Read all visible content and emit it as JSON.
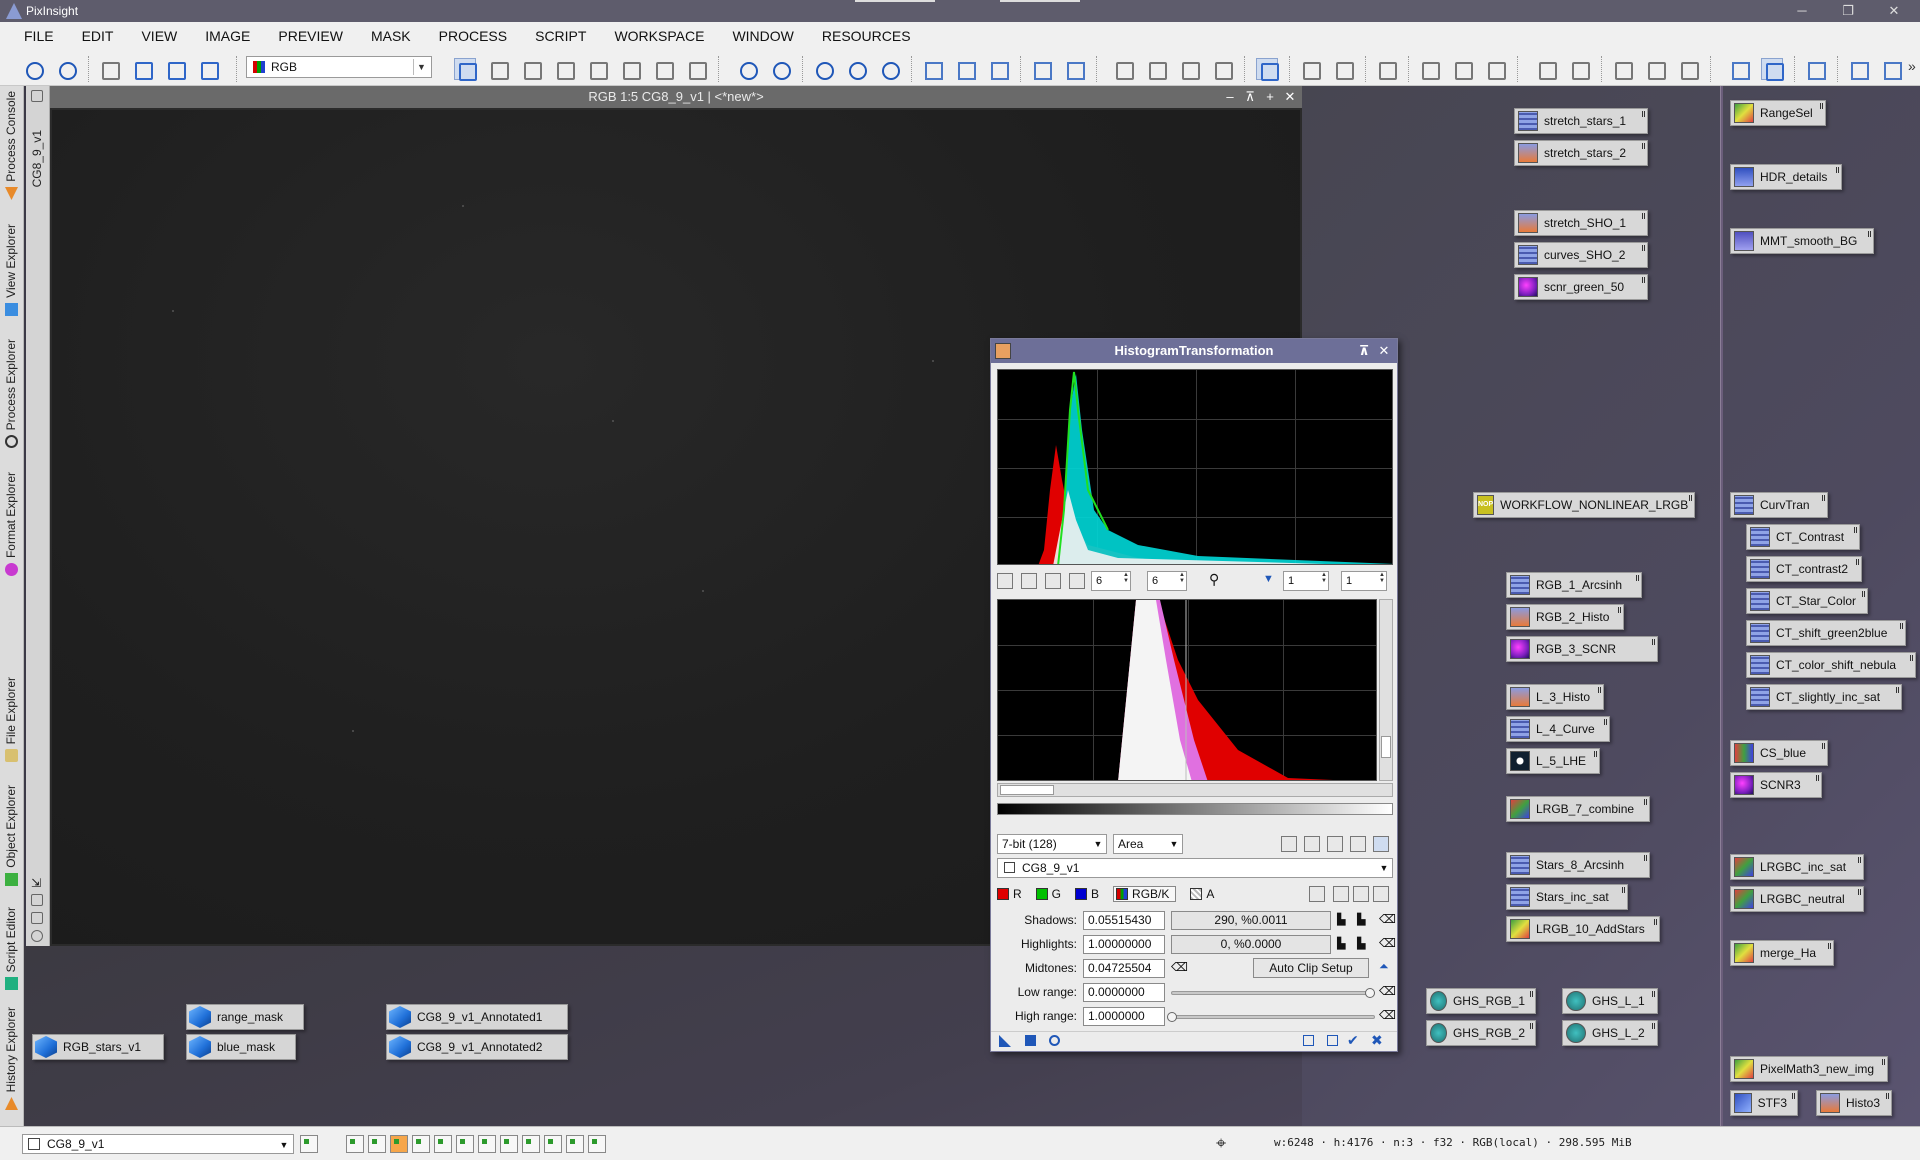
{
  "app": {
    "title": "PixInsight"
  },
  "menu": [
    "FILE",
    "EDIT",
    "VIEW",
    "IMAGE",
    "PREVIEW",
    "MASK",
    "PROCESS",
    "SCRIPT",
    "WORKSPACE",
    "WINDOW",
    "RESOURCES"
  ],
  "toolbar": {
    "channel_select": "RGB",
    "overflow": "»"
  },
  "left_dock": [
    "Process Console",
    "View Explorer",
    "Process Explorer",
    "Format Explorer",
    "File Explorer",
    "Object Explorer",
    "Script Editor",
    "History Explorer"
  ],
  "image_window": {
    "title": "RGB 1:5 CG8_9_v1 | <*new*>",
    "side_label": "CG8_9_v1"
  },
  "process_icons": [
    {
      "label": "stretch_stars_1",
      "kind": "grid"
    },
    {
      "label": "stretch_stars_2",
      "kind": "histo"
    },
    {
      "label": "stretch_SHO_1",
      "kind": "histo"
    },
    {
      "label": "curves_SHO_2",
      "kind": "grid"
    },
    {
      "label": "scnr_green_50",
      "kind": "scnr"
    },
    {
      "label": "WORKFLOW_NONLINEAR_LRGB",
      "kind": "nop"
    },
    {
      "label": "RGB_1_Arcsinh",
      "kind": "grid"
    },
    {
      "label": "RGB_2_Histo",
      "kind": "histo"
    },
    {
      "label": "RGB_3_SCNR",
      "kind": "scnr"
    },
    {
      "label": "L_3_Histo",
      "kind": "histo"
    },
    {
      "label": "L_4_Curve",
      "kind": "grid"
    },
    {
      "label": "L_5_LHE",
      "kind": "lhe"
    },
    {
      "label": "LRGB_7_combine",
      "kind": "lrgb"
    },
    {
      "label": "Stars_8_Arcsinh",
      "kind": "grid"
    },
    {
      "label": "Stars_inc_sat",
      "kind": "grid"
    },
    {
      "label": "LRGB_10_AddStars",
      "kind": "pm"
    },
    {
      "label": "GHS_RGB_1",
      "kind": "ghs"
    },
    {
      "label": "GHS_L_1",
      "kind": "ghs"
    },
    {
      "label": "GHS_RGB_2",
      "kind": "ghs"
    },
    {
      "label": "GHS_L_2",
      "kind": "ghs"
    },
    {
      "label": "RangeSel",
      "kind": "pm"
    },
    {
      "label": "HDR_details",
      "kind": "hdr"
    },
    {
      "label": "MMT_smooth_BG",
      "kind": "mmt"
    },
    {
      "label": "CurvTran",
      "kind": "grid"
    },
    {
      "label": "CT_Contrast",
      "kind": "grid"
    },
    {
      "label": "CT_contrast2",
      "kind": "grid"
    },
    {
      "label": "CT_Star_Color",
      "kind": "grid"
    },
    {
      "label": "CT_shift_green2blue",
      "kind": "grid"
    },
    {
      "label": "CT_color_shift_nebula",
      "kind": "grid"
    },
    {
      "label": "CT_slightly_inc_sat",
      "kind": "grid"
    },
    {
      "label": "CS_blue",
      "kind": "cs"
    },
    {
      "label": "SCNR3",
      "kind": "scnr"
    },
    {
      "label": "LRGBC_inc_sat",
      "kind": "lrgb"
    },
    {
      "label": "LRGBC_neutral",
      "kind": "lrgb"
    },
    {
      "label": "merge_Ha",
      "kind": "pm"
    },
    {
      "label": "PixelMath3_new_img",
      "kind": "pm"
    },
    {
      "label": "STF3",
      "kind": "stf"
    },
    {
      "label": "Histo3",
      "kind": "histo"
    }
  ],
  "image_icons": [
    {
      "label": "RGB_stars_v1"
    },
    {
      "label": "range_mask"
    },
    {
      "label": "blue_mask"
    },
    {
      "label": "CG8_9_v1_Annotated1"
    },
    {
      "label": "CG8_9_v1_Annotated2"
    }
  ],
  "histogram_dialog": {
    "title": "HistogramTransformation",
    "zoom_h": "6",
    "zoom_v": "6",
    "out_zoom_h": "1",
    "out_zoom_v": "1",
    "resolution": "7-bit (128)",
    "graph_style": "Area",
    "view": "CG8_9_v1",
    "channels": [
      {
        "label": "R",
        "color": "#e00000"
      },
      {
        "label": "G",
        "color": "#00c000"
      },
      {
        "label": "B",
        "color": "#0000d0"
      },
      {
        "label": "RGB/K",
        "color": "#1f3fbf"
      },
      {
        "label": "A",
        "color": "#888888"
      }
    ],
    "shadows_label": "Shadows:",
    "shadows": "0.05515430",
    "shadows_clip": "290, %0.0011",
    "highlights_label": "Highlights:",
    "highlights": "1.00000000",
    "highlights_clip": "0, %0.0000",
    "midtones_label": "Midtones:",
    "midtones": "0.04725504",
    "auto_clip": "Auto Clip Setup",
    "low_range_label": "Low range:",
    "low_range": "0.0000000",
    "high_range_label": "High range:",
    "high_range": "1.0000000"
  },
  "statusbar": {
    "view": "CG8_9_v1",
    "info": "w:6248 · h:4176 · n:3 · f32 · RGB(local) · 298.595 MiB"
  }
}
